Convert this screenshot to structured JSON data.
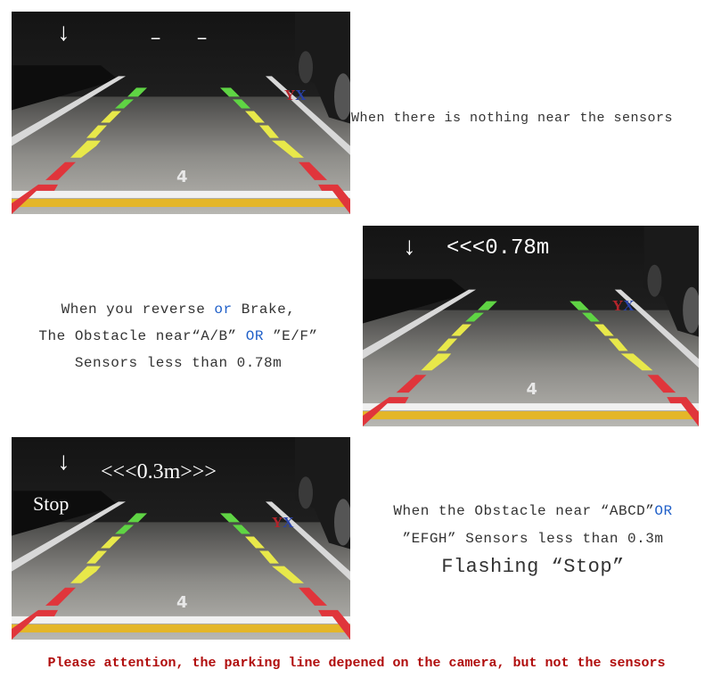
{
  "panels": [
    {
      "id": "nothing-near",
      "overlay": {
        "dashes": [
          "–",
          "–"
        ]
      },
      "labels": {
        "y": "Y",
        "x": "X"
      },
      "caption": {
        "text": "When there is nothing near the sensors"
      }
    },
    {
      "id": "reverse-078",
      "overlay": {
        "distance": "<<<0.78m"
      },
      "labels": {
        "y": "Y",
        "x": "X"
      },
      "caption": {
        "line1_a": "When you reverse ",
        "line1_or": "or",
        "line1_b": " Brake,",
        "line2_a": "The Obstacle near“A/B” ",
        "line2_or": "OR",
        "line2_b": " ”E/F”",
        "line3": "Sensors less than 0.78m"
      }
    },
    {
      "id": "stop-03",
      "overlay": {
        "distance": "<<<0.3m>>>",
        "stop": "Stop"
      },
      "labels": {
        "y": "Y",
        "x": "X"
      },
      "caption": {
        "line1_a": "When the Obstacle near “ABCD”",
        "line1_or": "OR",
        "line2": "”EFGH” Sensors less than 0.3m",
        "line3": "Flashing “Stop”"
      }
    }
  ],
  "footer": "Please attention, the parking line depened on the camera, but not the sensors",
  "colors": {
    "accent_blue": "#1f5fc8",
    "warning_red": "#b00c0c",
    "guide_green": "#5fd444",
    "guide_yellow": "#e8e84a",
    "guide_red": "#e0353b"
  }
}
